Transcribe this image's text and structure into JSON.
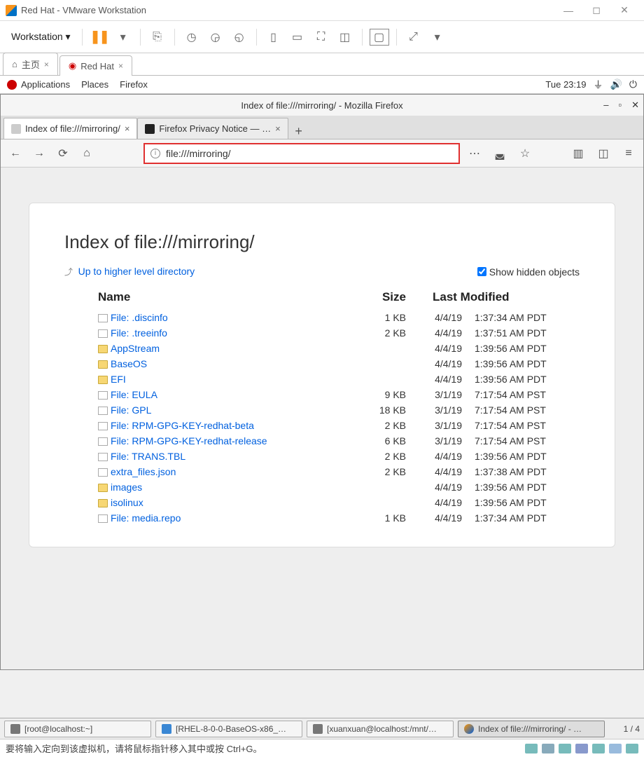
{
  "vm": {
    "title": "Red Hat - VMware Workstation",
    "menu": "Workstation ▾",
    "tabs": {
      "home": "主页",
      "redhat": "Red Hat"
    }
  },
  "guest_panel": {
    "apps": "Applications",
    "places": "Places",
    "firefox": "Firefox",
    "clock": "Tue 23:19"
  },
  "firefox": {
    "window_title": "Index of file:///mirroring/ - Mozilla Firefox",
    "tabs": [
      {
        "label": "Index of file:///mirroring/"
      },
      {
        "label": "Firefox Privacy Notice — …"
      }
    ],
    "url": "file:///mirroring/"
  },
  "listing": {
    "heading": "Index of file:///mirroring/",
    "uplink": "Up to higher level directory",
    "show_hidden": "Show hidden objects",
    "headers": {
      "name": "Name",
      "size": "Size",
      "modified": "Last Modified"
    },
    "rows": [
      {
        "icon": "file",
        "name": "File: .discinfo",
        "size": "1 KB",
        "date": "4/4/19",
        "time": "1:37:34 AM PDT"
      },
      {
        "icon": "file",
        "name": "File: .treeinfo",
        "size": "2 KB",
        "date": "4/4/19",
        "time": "1:37:51 AM PDT"
      },
      {
        "icon": "folder",
        "name": "AppStream",
        "size": "",
        "date": "4/4/19",
        "time": "1:39:56 AM PDT"
      },
      {
        "icon": "folder",
        "name": "BaseOS",
        "size": "",
        "date": "4/4/19",
        "time": "1:39:56 AM PDT"
      },
      {
        "icon": "folder",
        "name": "EFI",
        "size": "",
        "date": "4/4/19",
        "time": "1:39:56 AM PDT"
      },
      {
        "icon": "file",
        "name": "File: EULA",
        "size": "9 KB",
        "date": "3/1/19",
        "time": "7:17:54 AM PST"
      },
      {
        "icon": "file",
        "name": "File: GPL",
        "size": "18 KB",
        "date": "3/1/19",
        "time": "7:17:54 AM PST"
      },
      {
        "icon": "file",
        "name": "File: RPM-GPG-KEY-redhat-beta",
        "size": "2 KB",
        "date": "3/1/19",
        "time": "7:17:54 AM PST"
      },
      {
        "icon": "file",
        "name": "File: RPM-GPG-KEY-redhat-release",
        "size": "6 KB",
        "date": "3/1/19",
        "time": "7:17:54 AM PST"
      },
      {
        "icon": "file",
        "name": "File: TRANS.TBL",
        "size": "2 KB",
        "date": "4/4/19",
        "time": "1:39:56 AM PDT"
      },
      {
        "icon": "file",
        "name": "extra_files.json",
        "size": "2 KB",
        "date": "4/4/19",
        "time": "1:37:38 AM PDT"
      },
      {
        "icon": "folder",
        "name": "images",
        "size": "",
        "date": "4/4/19",
        "time": "1:39:56 AM PDT"
      },
      {
        "icon": "folder",
        "name": "isolinux",
        "size": "",
        "date": "4/4/19",
        "time": "1:39:56 AM PDT"
      },
      {
        "icon": "file",
        "name": "File: media.repo",
        "size": "1 KB",
        "date": "4/4/19",
        "time": "1:37:34 AM PDT"
      }
    ]
  },
  "taskbar": {
    "items": [
      "[root@localhost:~]",
      "[RHEL-8-0-0-BaseOS-x86_…",
      "[xuanxuan@localhost:/mnt/…",
      "Index of file:///mirroring/ - …"
    ],
    "tray": "1 / 4"
  },
  "status_hint": "要将输入定向到该虚拟机，请将鼠标指针移入其中或按 Ctrl+G。"
}
